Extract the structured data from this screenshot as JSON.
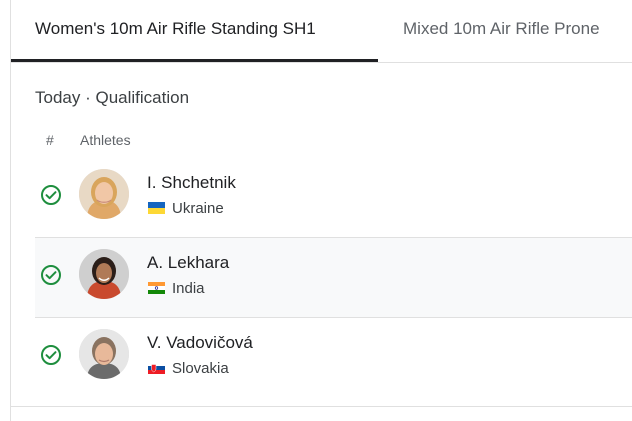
{
  "tabs": [
    {
      "label": "Women's 10m Air Rifle Standing SH1",
      "active": true
    },
    {
      "label": "Mixed 10m Air Rifle Prone",
      "active": false
    }
  ],
  "section": {
    "title": "Today · Qualification"
  },
  "columns": {
    "rank": "#",
    "athletes": "Athletes"
  },
  "athletes": [
    {
      "name": "I. Shchetnik",
      "country": "Ukraine",
      "status": "check-circle-icon",
      "flag": "ukraine-flag-icon"
    },
    {
      "name": "A. Lekhara",
      "country": "India",
      "status": "check-circle-icon",
      "flag": "india-flag-icon"
    },
    {
      "name": "V. Vadovičová",
      "country": "Slovakia",
      "status": "check-circle-icon",
      "flag": "slovakia-flag-icon"
    }
  ],
  "colors": {
    "check": "#1e8e3e",
    "active_tab": "#202124",
    "divider": "#e0e0e0",
    "row_highlight": "#f8f9fa"
  }
}
